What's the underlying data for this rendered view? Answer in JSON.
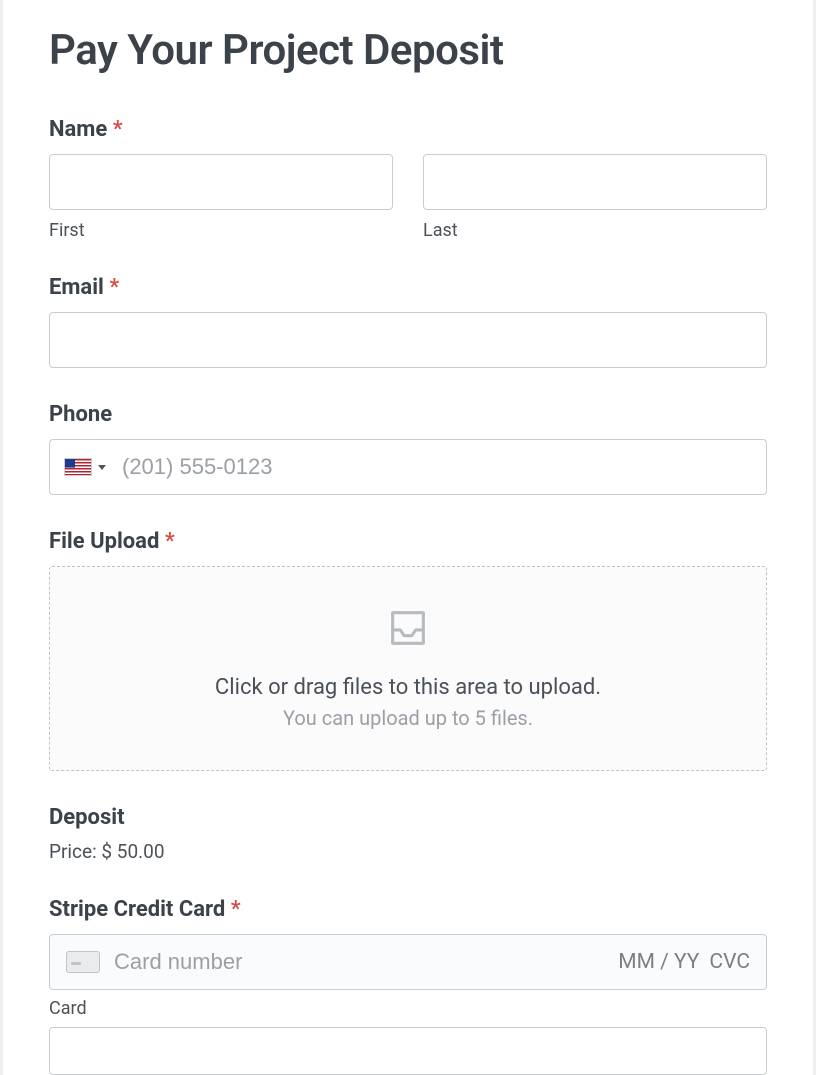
{
  "title": "Pay Your Project Deposit",
  "name": {
    "label": "Name",
    "required": "*",
    "first_sublabel": "First",
    "last_sublabel": "Last",
    "first_value": "",
    "last_value": ""
  },
  "email": {
    "label": "Email",
    "required": "*",
    "value": ""
  },
  "phone": {
    "label": "Phone",
    "country": "us",
    "placeholder": "(201) 555-0123",
    "value": ""
  },
  "upload": {
    "label": "File Upload",
    "required": "*",
    "line1": "Click or drag files to this area to upload.",
    "line2": "You can upload up to 5 files."
  },
  "deposit": {
    "label": "Deposit",
    "price_text": "Price: $ 50.00"
  },
  "card": {
    "label": "Stripe Credit Card",
    "required": "*",
    "number_placeholder": "Card number",
    "expiry_placeholder": "MM / YY",
    "cvc_placeholder": "CVC",
    "sublabel": "Card"
  }
}
